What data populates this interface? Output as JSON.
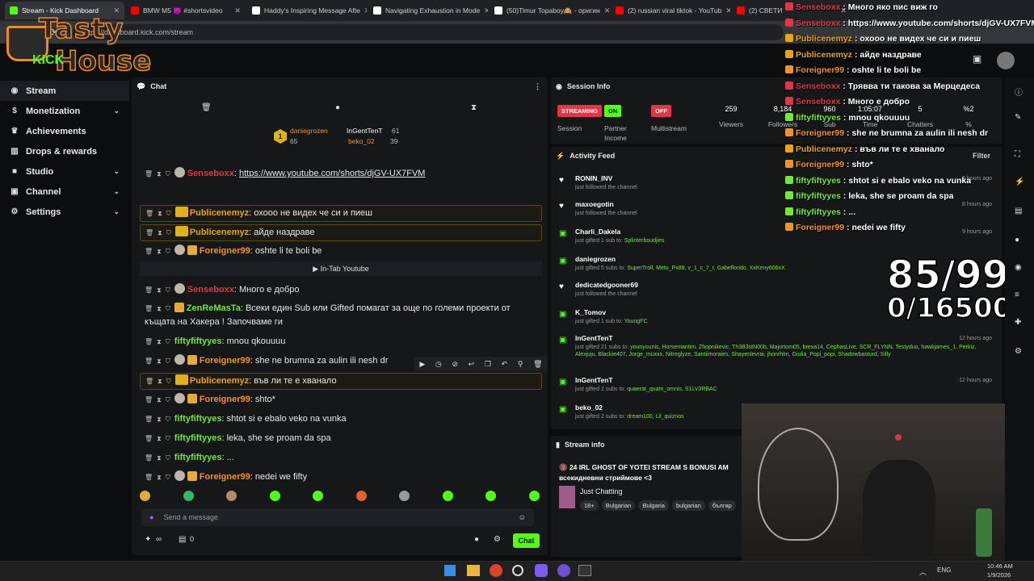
{
  "browser": {
    "tabs": [
      {
        "title": "Stream - Kick Dashboard",
        "active": true,
        "color": "#53fc18"
      },
      {
        "title": "BMW M5 😈 #shortsvideo",
        "color": "#ff0000"
      },
      {
        "title": "Haddy's Inspiring Message Afte",
        "color": "#ffffff"
      },
      {
        "title": "Navigating Exhaustion in Mode",
        "color": "#ffffff"
      },
      {
        "title": "(50)Timur Topaboy🙈 - оригин",
        "color": "#ffffff"
      },
      {
        "title": "(2) russian viral tiktok - YouTub",
        "color": "#ff0000"
      },
      {
        "title": "(2) СВЕТИ",
        "color": "#ff0000"
      }
    ],
    "url": "https://dashboard.kick.com/stream"
  },
  "logo": {
    "line1": "Tasty",
    "line2": "House",
    "kick": "KICK"
  },
  "sidebar": {
    "items": [
      {
        "label": "Stream",
        "icon": "stream-icon"
      },
      {
        "label": "Monetization",
        "icon": "dollar-icon"
      },
      {
        "label": "Achievements",
        "icon": "trophy-icon"
      },
      {
        "label": "Drops & rewards",
        "icon": "drops-icon"
      },
      {
        "label": "Studio",
        "icon": "studio-icon"
      },
      {
        "label": "Channel",
        "icon": "channel-icon"
      },
      {
        "label": "Settings",
        "icon": "gear-icon"
      }
    ]
  },
  "chat": {
    "title": "Chat",
    "leaderboard": {
      "rank": "1",
      "first": {
        "name": "daniegrozen",
        "value": "65"
      },
      "second": {
        "name": "InGentTenT",
        "value": "61"
      },
      "third": {
        "name": "beko_02",
        "value": "39"
      }
    },
    "messages": [
      {
        "user": "Senseboxx",
        "color": "r",
        "text": "https://www.youtube.com/shorts/djGV-UX7FVM",
        "link": true
      },
      {
        "user": "Publicenemyz",
        "color": "y",
        "text": "охооо не видех че си и пиеш",
        "highlight": true,
        "crown": true
      },
      {
        "user": "Publicenemyz",
        "color": "y",
        "text": "айде наздраве",
        "highlight": true,
        "crown": true
      },
      {
        "user": "Foreigner99",
        "color": "o",
        "text": "oshte li te boli be",
        "gift": true
      },
      {
        "user": "Senseboxx",
        "color": "r",
        "text": "Трявва ти такова за Мерцедеса"
      },
      {
        "user": "Senseboxx",
        "color": "r",
        "text": "Много е добро"
      },
      {
        "user": "ZenReMasTa",
        "color": "g",
        "text": "Всеки един Sub или Gifted помагат за още по големи проекти от къщата на Хакера ! Започваме ги",
        "gift": true
      },
      {
        "user": "fiftyfiftyyes",
        "color": "g",
        "text": "mnou qkouuuu"
      },
      {
        "user": "Foreigner99",
        "color": "o",
        "text": "she ne brumna za aulin ili nesh dr",
        "gift": true
      },
      {
        "user": "Publicenemyz",
        "color": "y",
        "text": "във ли те е хванало",
        "highlight": true,
        "crown": true
      },
      {
        "user": "Foreigner99",
        "color": "o",
        "text": "shto*",
        "gift": true
      },
      {
        "user": "fiftyfiftyyes",
        "color": "g",
        "text": "shtot si e ebalo veko na vunka"
      },
      {
        "user": "fiftyfiftyyes",
        "color": "g",
        "text": "leka, she se proam da spa"
      },
      {
        "user": "fiftyfiftyyes",
        "color": "g",
        "text": "..."
      },
      {
        "user": "Foreigner99",
        "color": "o",
        "text": "nedei we fifty",
        "gift": true
      }
    ],
    "youtube_label": "In-Tab Youtube",
    "placeholder": "Send a message",
    "footer_infinity": "∞",
    "footer_count": "0",
    "send_label": "Chat"
  },
  "session": {
    "title": "Session Info",
    "badges": [
      {
        "label": "STREAMING",
        "color": "#e0364a",
        "caption": "Session"
      },
      {
        "label": "ON",
        "color": "#53fc18",
        "caption": "Partner Income"
      },
      {
        "label": "OFF",
        "color": "#e0364a",
        "caption": "Multistream"
      }
    ],
    "stats": [
      {
        "value": "259",
        "label": "Viewers"
      },
      {
        "value": "8,184",
        "label": "Followers"
      },
      {
        "value": "960",
        "label": "Sub"
      },
      {
        "value": "1:05:07",
        "label": "Time"
      },
      {
        "value": "5",
        "label": "Chatters"
      },
      {
        "value": "%2",
        "label": "%"
      }
    ]
  },
  "activity": {
    "title": "Activity Feed",
    "filter": "Filter",
    "items": [
      {
        "name": "RONIN_INV",
        "sub": "just followed the channel",
        "icon": "heart-icon",
        "time": "3 hours ago"
      },
      {
        "name": "maxoegotin",
        "sub": "just followed the channel",
        "icon": "heart-icon",
        "time": "8 hours ago"
      },
      {
        "name": "Charli_Dakela",
        "sub": "just gifted 1 sub to:",
        "extra": "Splinterboudjies",
        "icon": "gift-icon",
        "time": "9 hours ago"
      },
      {
        "name": "daniegrozen",
        "sub": "just gifted 5 subs to:",
        "extra": "SuperTroll, Meto_Px88, v_1_c_7_r, Gabeflorido, XxKeny606xX",
        "icon": "gift-icon",
        "time": ""
      },
      {
        "name": "dedicatedgooner69",
        "sub": "just followed the channel",
        "icon": "heart-icon",
        "time": ""
      },
      {
        "name": "K_Tomov",
        "sub": "just gifted 1 sub to:",
        "extra": "YoungFC",
        "icon": "gift-icon",
        "time": ""
      },
      {
        "name": "InGentTenT",
        "sub": "just gifted 21 subs to:",
        "extra": "younyounis, Horsemantim, Zhopnikevic, Th3B3stN00b, Majortom05, brexa14, CephasLive, SCR_FLYNN, Testyduo, hawkjames_1, Perkiz, Alexjuju, Blackie407, Jorge_muxxx, Nitreglyze, Santiimorales, Shayenlevrai, jhonrhlm, Giulia_Popi_popi, Shadowbasturd, Silly",
        "icon": "gift-icon",
        "time": "12 hours ago"
      },
      {
        "name": "InGentTenT",
        "sub": "just gifted 2 subs to:",
        "extra": "quaerat_quam_omnis, S1LV3RBAC",
        "icon": "gift-icon",
        "time": "12 hours ago"
      },
      {
        "name": "beko_02",
        "sub": "just gifted 2 subs to:",
        "extra": "dream100, Lil_quiznos",
        "icon": "gift-icon",
        "time": ""
      }
    ]
  },
  "stream_info": {
    "title": "Stream info",
    "stream_title": "🔞 24 IRL GHOST OF YOTEI STREAM S BONUSI AM",
    "stream_sub": "всекидневни стриймове <3",
    "category": "Just Chatting",
    "tags": [
      "18+",
      "Bulgarian",
      "Bulgaria",
      "bulgarian",
      "българ"
    ]
  },
  "overlay_chat": [
    {
      "user": "Senseboxx",
      "color": "#e0364a",
      "text": "Много яко пис виж го"
    },
    {
      "user": "Senseboxx",
      "color": "#e0364a",
      "text": "https://www.youtube.com/shorts/djGV-UX7FVM"
    },
    {
      "user": "Publicenemyz",
      "color": "#e8a317",
      "text": "охооо не видех че си и пиеш"
    },
    {
      "user": "Publicenemyz",
      "color": "#e8a317",
      "text": "айде наздраве"
    },
    {
      "user": "Foreigner99",
      "color": "#f0932b",
      "text": "oshte li te boli be"
    },
    {
      "user": "Senseboxx",
      "color": "#e0364a",
      "text": "Трявва ти такова за Мерцедеса"
    },
    {
      "user": "Senseboxx",
      "color": "#e0364a",
      "text": "Много е добро"
    },
    {
      "user": "fiftyfiftyyes",
      "color": "#74e63b",
      "text": "mnou qkouuuu"
    },
    {
      "user": "Foreigner99",
      "color": "#f0932b",
      "text": "she ne brumna za aulin ili nesh dr"
    },
    {
      "user": "Publicenemyz",
      "color": "#e8a317",
      "text": "във ли те е хванало"
    },
    {
      "user": "Foreigner99",
      "color": "#f0932b",
      "text": "shto*"
    },
    {
      "user": "fiftyfiftyyes",
      "color": "#74e63b",
      "text": "shtot si e ebalo veko na vunka"
    },
    {
      "user": "fiftyfiftyyes",
      "color": "#74e63b",
      "text": "leka, she se proam da spa"
    },
    {
      "user": "fiftyfiftyyes",
      "color": "#74e63b",
      "text": "..."
    },
    {
      "user": "Foreigner99",
      "color": "#f0932b",
      "text": "nedei we fifty"
    }
  ],
  "goal": {
    "line1": "85/99",
    "line2": "0/16500"
  },
  "taskbar": {
    "lang": "ENG",
    "time": "10:46 AM",
    "date": "1/9/2026"
  }
}
